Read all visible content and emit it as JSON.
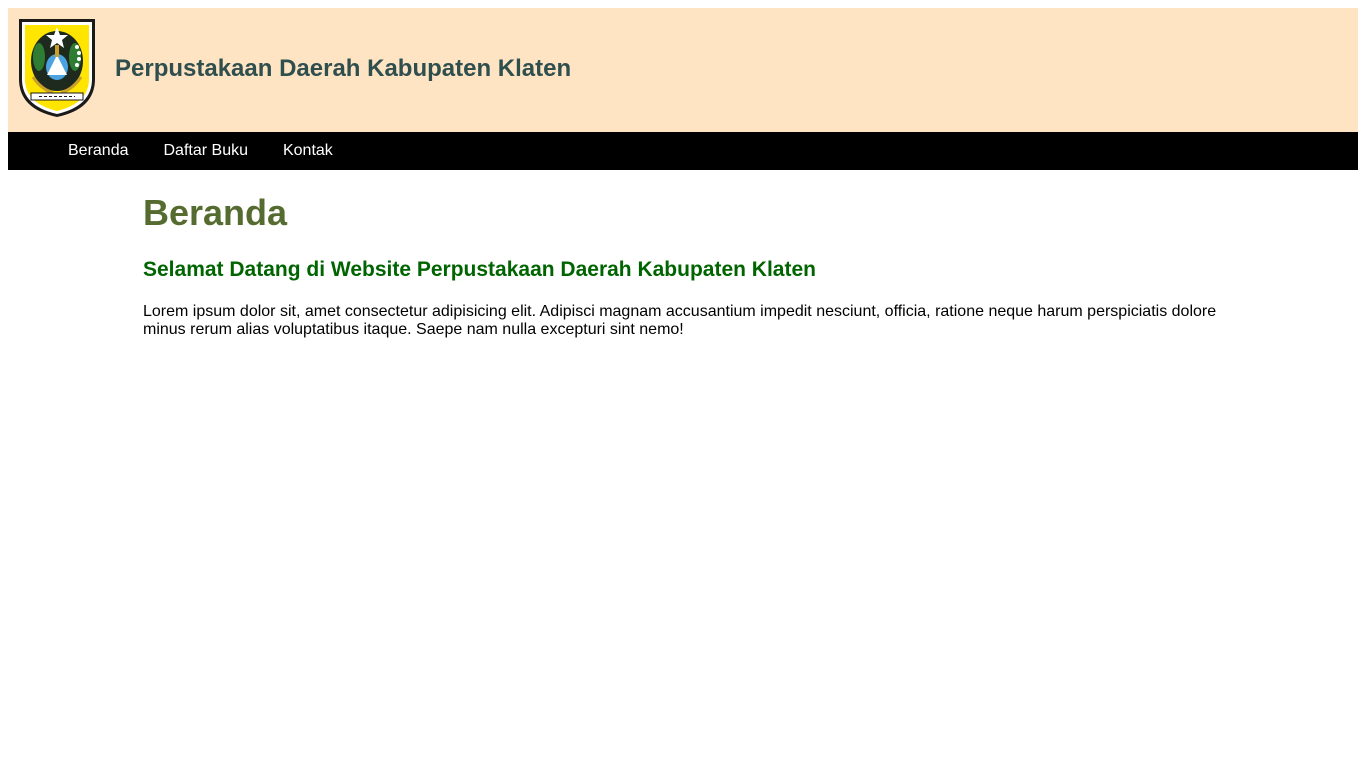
{
  "header": {
    "logo_icon": "klaten-regency-crest-icon",
    "title": "Perpustakaan Daerah Kabupaten Klaten",
    "background_color": "#ffe4c4",
    "title_color": "#2f4f4f"
  },
  "nav": {
    "background_color": "#000000",
    "items": [
      {
        "label": "Beranda"
      },
      {
        "label": "Daftar Buku"
      },
      {
        "label": "Kontak"
      }
    ]
  },
  "main": {
    "page_title": "Beranda",
    "welcome_heading": "Selamat Datang di Website Perpustakaan Daerah Kabupaten Klaten",
    "intro_text": "Lorem ipsum dolor sit, amet consectetur adipisicing elit. Adipisci magnam accusantium impedit nesciunt, officia, ratione neque harum perspiciatis dolore minus rerum alias voluptatibus itaque. Saepe nam nulla excepturi sint nemo!",
    "page_title_color": "#556b2f",
    "welcome_color": "#006400"
  }
}
